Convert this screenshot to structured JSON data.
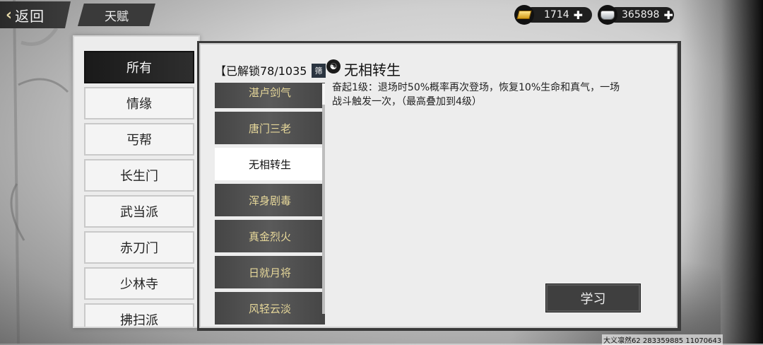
{
  "header": {
    "back_label": "返回",
    "page_title": "天赋"
  },
  "currency": {
    "gold": "1714",
    "silver": "365898"
  },
  "categories": [
    {
      "label": "所有",
      "active": true
    },
    {
      "label": "情缘"
    },
    {
      "label": "丐帮"
    },
    {
      "label": "长生门"
    },
    {
      "label": "武当派"
    },
    {
      "label": "赤刀门"
    },
    {
      "label": "少林寺"
    },
    {
      "label": "拂扫派"
    }
  ],
  "talents": {
    "counter": "【已解锁78/1035",
    "filter_label": "筛",
    "items": [
      {
        "label": "湛卢剑气"
      },
      {
        "label": "唐门三老"
      },
      {
        "label": "无相转生",
        "active": true
      },
      {
        "label": "浑身剧毒"
      },
      {
        "label": "真金烈火"
      },
      {
        "label": "日就月将"
      },
      {
        "label": "风轻云淡"
      }
    ]
  },
  "detail": {
    "title": "无相转生",
    "description": "奋起1级：退场时50%概率再次登场，恢复10%生命和真气，一场战斗触发一次，（最高叠加到4级）"
  },
  "actions": {
    "learn_label": "学习"
  },
  "footer": {
    "player_info": "大义凛然62 283359885 11070643"
  }
}
